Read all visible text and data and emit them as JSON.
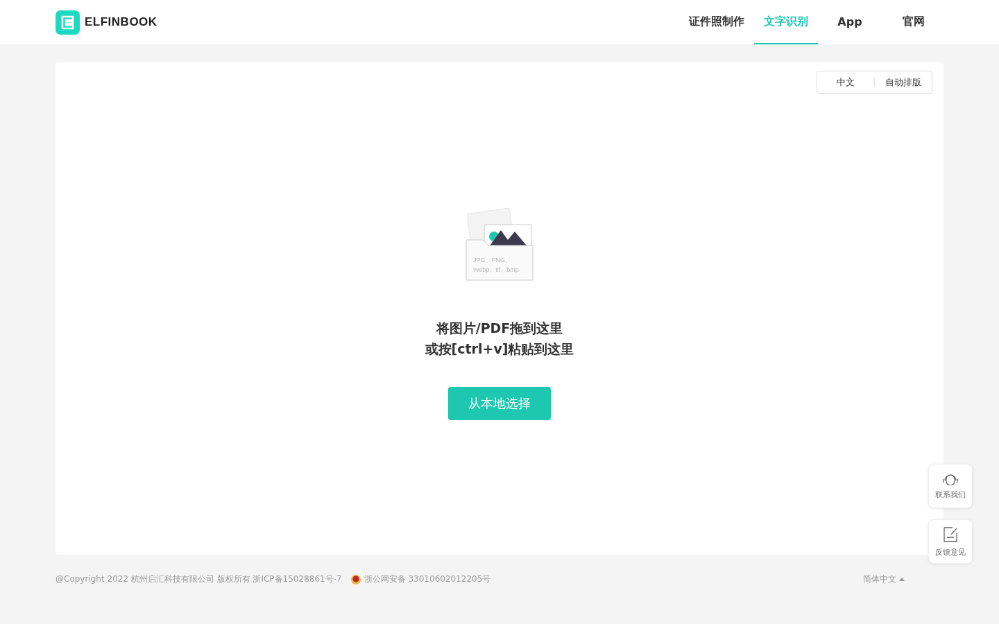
{
  "header": {
    "logo_text": "ELFINBOOK",
    "nav": [
      {
        "label": "证件照制作",
        "selected": false
      },
      {
        "label": "文字识别",
        "selected": true
      },
      {
        "label": "App",
        "selected": false
      },
      {
        "label": "官网",
        "selected": false
      }
    ]
  },
  "options": {
    "language": "中文",
    "layout": "自动排版"
  },
  "upload": {
    "formats_line_1": "JPG、PNG、",
    "formats_line_2": "Webp、tif、bmp",
    "hint_line_1": "将图片/PDF拖到这里",
    "hint_line_2": "或按[ctrl+v]粘贴到这里",
    "button": "从本地选择"
  },
  "side_buttons": [
    {
      "kind": "contact",
      "label": "联系我们"
    },
    {
      "kind": "feedback",
      "label": "反馈意见"
    }
  ],
  "footer": {
    "copyright": "@Copyright 2022 杭州启汇科技有限公司 版权所有 浙ICP备15028861号-7",
    "police_record": "浙公网安备 33010602012205号",
    "language": "简体中文"
  }
}
